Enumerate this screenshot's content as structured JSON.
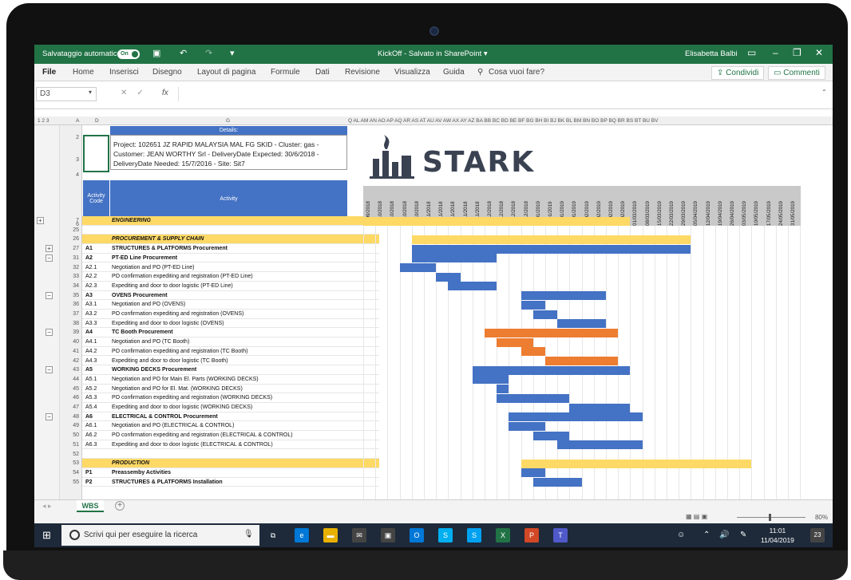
{
  "app": {
    "autosave_label": "Salvataggio automatico",
    "autosave_state": "On",
    "doc_title": "KickOff - Salvato in SharePoint ▾",
    "user": "Elisabetta Balbi"
  },
  "menu": [
    "File",
    "Home",
    "Inserisci",
    "Disegno",
    "Layout di pagina",
    "Formule",
    "Dati",
    "Revisione",
    "Visualizza",
    "Guida",
    "Cosa vuoi fare?"
  ],
  "share_label": "Condividi",
  "comments_label": "Commenti",
  "formula": {
    "namebox": "D3",
    "fx": "fx"
  },
  "columns": {
    "left": [
      "A",
      "D",
      "G"
    ],
    "gantt": "Q AL AM AN AO AP AQ AR AS AT AU AV AW AX AY AZ BA BB BC BD BE BF BG BH BI BJ BK BL BM BN BO BP BQ BR BS BT BU BV"
  },
  "details": {
    "header": "Details:",
    "text": "Project: 102651 JZ RAPID MALAYSIA MAL FG SKID - Cluster: gas - Customer: JEAN WORTHY Srl - DeliveryDate Expected: 30/6/2018 - DeliveryDate Needed: 15/7/2016 - Site: Sit7"
  },
  "activity_code_header": "Activity Code",
  "activity_header": "Activity",
  "logo_text": "STARK",
  "dates": [
    "28/09/2018",
    "05/10/2018",
    "12/10/2018",
    "19/10/2018",
    "26/10/2018",
    "02/11/2018",
    "09/11/2018",
    "16/11/2018",
    "23/11/2018",
    "30/11/2018",
    "07/12/2018",
    "14/12/2018",
    "21/12/2018",
    "28/12/2018",
    "04/01/2019",
    "11/01/2019",
    "18/01/2019",
    "25/01/2019",
    "01/02/2019",
    "08/02/2019",
    "15/02/2019",
    "22/02/2019",
    "01/03/2019",
    "08/03/2019",
    "15/03/2019",
    "22/03/2019",
    "29/03/2019",
    "05/04/2019",
    "12/04/2019",
    "19/04/2019",
    "26/04/2019",
    "03/05/2019",
    "10/05/2019",
    "17/05/2019",
    "24/05/2019",
    "31/05/2019"
  ],
  "rows": [
    {
      "num": "7",
      "code": "",
      "name": "ENGINEERING",
      "style": "section",
      "bars": [
        {
          "s": 0,
          "e": 22,
          "c": "yellow"
        }
      ]
    },
    {
      "num": "25",
      "code": "",
      "name": "",
      "style": "",
      "bars": []
    },
    {
      "num": "26",
      "code": "",
      "name": "PROCUREMENT & SUPPLY CHAIN",
      "style": "section",
      "bars": [
        {
          "s": 4,
          "e": 27,
          "c": "yellow"
        }
      ]
    },
    {
      "num": "27",
      "code": "A1",
      "name": "STRUCTURES & PLATFORMS Procurement",
      "style": "bold",
      "bars": [
        {
          "s": 4,
          "e": 27,
          "c": "blue"
        }
      ]
    },
    {
      "num": "31",
      "code": "A2",
      "name": "PT-ED Line Procurement",
      "style": "bold",
      "bars": [
        {
          "s": 4,
          "e": 11,
          "c": "blue"
        }
      ]
    },
    {
      "num": "32",
      "code": "A2.1",
      "name": "Negotiation and PO (PT-ED Line)",
      "style": "",
      "bars": [
        {
          "s": 3,
          "e": 6,
          "c": "blue"
        }
      ]
    },
    {
      "num": "33",
      "code": "A2.2",
      "name": "PO confirmation expediting and registration (PT-ED Line)",
      "style": "",
      "bars": [
        {
          "s": 6,
          "e": 8,
          "c": "blue"
        }
      ]
    },
    {
      "num": "34",
      "code": "A2.3",
      "name": "Expediting  and door to door logistic (PT-ED Line)",
      "style": "",
      "bars": [
        {
          "s": 7,
          "e": 11,
          "c": "blue"
        }
      ]
    },
    {
      "num": "35",
      "code": "A3",
      "name": "OVENS Procurement",
      "style": "bold",
      "bars": [
        {
          "s": 13,
          "e": 20,
          "c": "blue"
        }
      ]
    },
    {
      "num": "36",
      "code": "A3.1",
      "name": "Negotiation and PO (OVENS)",
      "style": "",
      "bars": [
        {
          "s": 13,
          "e": 15,
          "c": "blue"
        }
      ]
    },
    {
      "num": "37",
      "code": "A3.2",
      "name": "PO confirmation expediting and registration (OVENS)",
      "style": "",
      "bars": [
        {
          "s": 14,
          "e": 16,
          "c": "blue"
        }
      ]
    },
    {
      "num": "38",
      "code": "A3.3",
      "name": "Expediting  and door to door logistic (OVENS)",
      "style": "",
      "bars": [
        {
          "s": 16,
          "e": 20,
          "c": "blue"
        }
      ]
    },
    {
      "num": "39",
      "code": "A4",
      "name": "TC Booth Procurement",
      "style": "bold",
      "bars": [
        {
          "s": 10,
          "e": 21,
          "c": "orange"
        }
      ]
    },
    {
      "num": "40",
      "code": "A4.1",
      "name": "Negotiation and PO (TC Booth)",
      "style": "",
      "bars": [
        {
          "s": 11,
          "e": 14,
          "c": "orange"
        }
      ]
    },
    {
      "num": "41",
      "code": "A4.2",
      "name": "PO confirmation expediting and registration (TC Booth)",
      "style": "",
      "bars": [
        {
          "s": 13,
          "e": 15,
          "c": "orange"
        }
      ]
    },
    {
      "num": "42",
      "code": "A4.3",
      "name": "Expediting  and door to door logistic (TC Booth)",
      "style": "",
      "bars": [
        {
          "s": 15,
          "e": 21,
          "c": "orange"
        }
      ]
    },
    {
      "num": "43",
      "code": "A5",
      "name": "WORKING DECKS Procurement",
      "style": "bold",
      "bars": [
        {
          "s": 9,
          "e": 22,
          "c": "blue"
        }
      ]
    },
    {
      "num": "44",
      "code": "A5.1",
      "name": "Negotiation and PO for  Main El. Parts (WORKING DECKS)",
      "style": "",
      "bars": [
        {
          "s": 9,
          "e": 12,
          "c": "blue"
        }
      ]
    },
    {
      "num": "45",
      "code": "A5.2",
      "name": "Negotiation and PO for El. Mat. (WORKING DECKS)",
      "style": "",
      "bars": [
        {
          "s": 11,
          "e": 12,
          "c": "blue"
        }
      ]
    },
    {
      "num": "46",
      "code": "A5.3",
      "name": "PO confirmation expediting and registration (WORKING DECKS)",
      "style": "",
      "bars": [
        {
          "s": 11,
          "e": 17,
          "c": "blue"
        }
      ]
    },
    {
      "num": "47",
      "code": "A5.4",
      "name": "Expediting  and door to door logistic (WORKING DECKS)",
      "style": "",
      "bars": [
        {
          "s": 17,
          "e": 22,
          "c": "blue"
        }
      ]
    },
    {
      "num": "48",
      "code": "A6",
      "name": "ELECTRICAL & CONTROL Procurement",
      "style": "bold",
      "bars": [
        {
          "s": 12,
          "e": 23,
          "c": "blue"
        }
      ]
    },
    {
      "num": "49",
      "code": "A6.1",
      "name": "Negotiation and PO (ELECTRICAL & CONTROL)",
      "style": "",
      "bars": [
        {
          "s": 12,
          "e": 15,
          "c": "blue"
        }
      ]
    },
    {
      "num": "50",
      "code": "A6.2",
      "name": "PO confirmation expediting and registration (ELECTRICAL & CONTROL)",
      "style": "",
      "bars": [
        {
          "s": 14,
          "e": 17,
          "c": "blue"
        }
      ]
    },
    {
      "num": "51",
      "code": "A6.3",
      "name": "Expediting  and door to door logistic (ELECTRICAL & CONTROL)",
      "style": "",
      "bars": [
        {
          "s": 16,
          "e": 23,
          "c": "blue"
        }
      ]
    },
    {
      "num": "52",
      "code": "",
      "name": "",
      "style": "",
      "bars": []
    },
    {
      "num": "53",
      "code": "",
      "name": "PRODUCTION",
      "style": "section",
      "bars": [
        {
          "s": 13,
          "e": 32,
          "c": "yellow"
        }
      ]
    },
    {
      "num": "54",
      "code": "P1",
      "name": "Preassemby Activities",
      "style": "bold",
      "bars": [
        {
          "s": 13,
          "e": 15,
          "c": "blue"
        }
      ]
    },
    {
      "num": "55",
      "code": "P2",
      "name": "STRUCTURES & PLATFORMS Installation",
      "style": "bold",
      "bars": [
        {
          "s": 14,
          "e": 18,
          "c": "blue"
        }
      ]
    }
  ],
  "top_rows": [
    "2",
    "3",
    "4",
    "6"
  ],
  "sheet_tab": "WBS",
  "zoom": "80%",
  "taskbar": {
    "search_placeholder": "Scrivi qui per eseguire la ricerca",
    "time": "11:01",
    "date": "11/04/2019",
    "notifications": "23"
  },
  "colors": {
    "excel_green": "#217346",
    "header_blue": "#4472c4",
    "bar_blue": "#4472c4",
    "bar_orange": "#ed7d31",
    "bar_yellow": "#ffd966"
  }
}
